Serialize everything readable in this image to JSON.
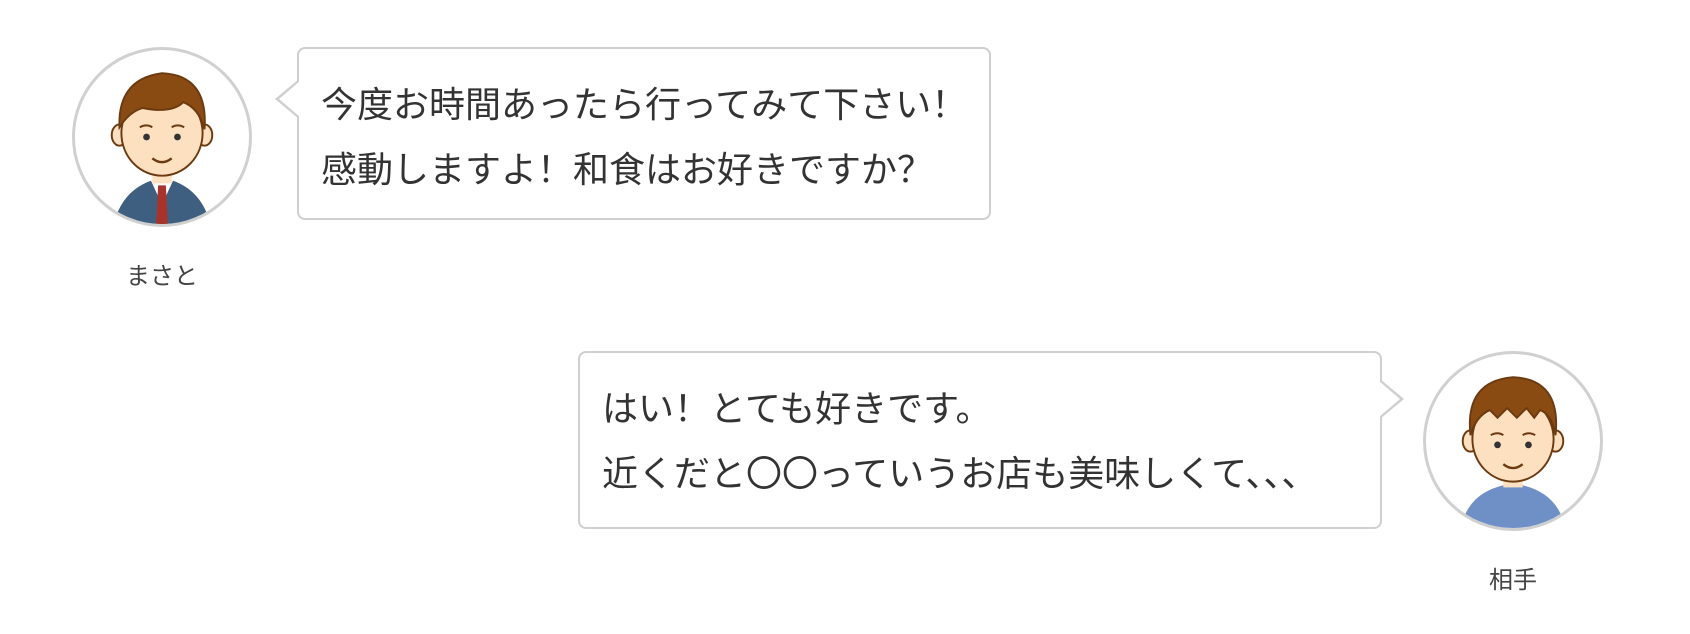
{
  "messages": [
    {
      "speaker": "まさと",
      "side": "left",
      "avatar_icon": "businessman-avatar-icon",
      "lines": [
        "今度お時間あったら行ってみて下さい！",
        "感動しますよ！和食はお好きですか？"
      ]
    },
    {
      "speaker": "相手",
      "side": "right",
      "avatar_icon": "boy-avatar-icon",
      "lines": [
        "はい！とても好きです。",
        "近くだと〇〇っていうお店も美味しくて、、、"
      ]
    }
  ],
  "colors": {
    "bubble_border": "#cfcfcf",
    "avatar_border": "#d0d0d0",
    "text": "#333333",
    "hair": "#8a4b12",
    "skin": "#fde0c0",
    "suit": "#3f5f80",
    "tie": "#a8332a",
    "shirt_blue": "#6f8fc7"
  }
}
